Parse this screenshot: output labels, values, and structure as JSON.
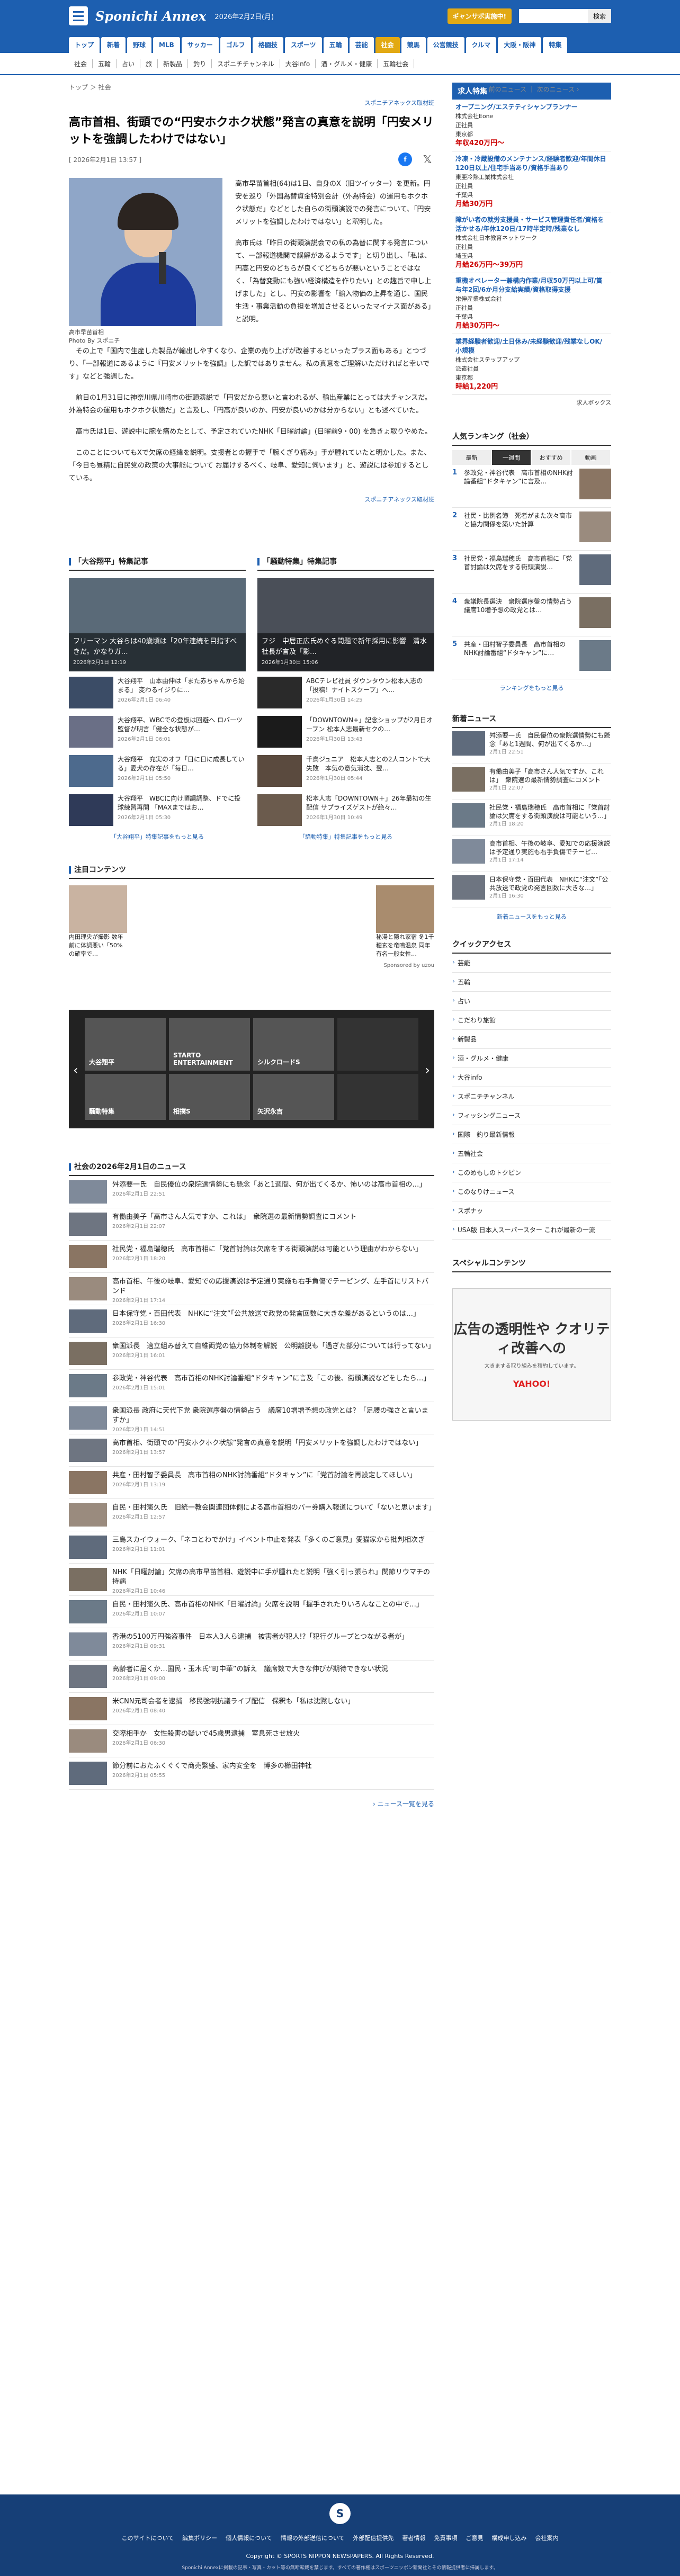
{
  "header": {
    "logo": "Sponichi Annex",
    "date": "2026年2月2日(月)",
    "smart_btn": "ギャンサポ実施中!",
    "search_btn": "検索",
    "search_placeholder": ""
  },
  "gnav": [
    "トップ",
    "新着",
    "野球",
    "MLB",
    "サッカー",
    "ゴルフ",
    "格闘技",
    "スポーツ",
    "五輪",
    "芸能",
    "社会",
    "競馬",
    "公営競技",
    "クルマ",
    "大阪・阪神",
    "特集"
  ],
  "snav": [
    "社会",
    "五輪",
    "占い",
    "旅",
    "新製品",
    "釣り",
    "スポニチチャンネル",
    "大谷info",
    "酒・グルメ・健康",
    "五輪社会"
  ],
  "breadcrumb": [
    "トップ",
    "社会"
  ],
  "pager": {
    "prev": "前のニュース",
    "next": "次のニュース"
  },
  "source_top": "スポニチアネックス取材班",
  "article": {
    "title": "高市首相、街頭での“円安ホクホク状態”発言の真意を説明「円安メリットを強調したわけではない」",
    "date": "[ 2026年2月1日 13:57 ]",
    "caption": "高市早苗首相\nPhoto By スポニチ",
    "p1": "高市早苗首相(64)は1日、自身のX（旧ツイッター）を更新。円安を巡り「外国為替資金特別会計（外為特会）の運用もホクホク状態だ」などとした自らの街頭演説での発言について、「円安メリットを強調したわけではない」と釈明した。",
    "p2": "高市氏は「昨日の街頭演説会での私の為替に関する発言について、一部報道機関で誤解があるようです」と切り出し、「私は、円高と円安のどちらが良くてどちらが悪いということではなく、「為替変動にも強い経済構造を作りたい」との趣旨で申し上げました」とし、円安の影響を「輸入物価の上昇を通じ、国民生活・事業活動の負担を増加させるといったマイナス面がある」と説明。",
    "p3": "その上で「国内で生産した製品が輸出しやすくなり、企業の売り上げが改善するといったプラス面もある」とつづり、「一部報道にあるように『円安メリットを強調』した訳ではありません。私の真意をご理解いただければと幸いです」などと強調した。",
    "p4": "前日の1月31日に神奈川県川崎市の街頭演説で「円安だから悪いと言われるが、輸出産業にとっては大チャンスだ。外為特会の運用もホクホク状態だ」と言及し、「円高が良いのか、円安が良いのかは分からない」とも述べていた。",
    "p5": "高市氏は1日、遊説中に腕を痛めたとして、予定されていたNHK「日曜討論」(日曜前9・00) を急きょ取りやめた。",
    "p6": "このことについてもXで欠席の経緯を説明。支援者との握手で「腕くぎり痛み」手が腫れていたと明かした。また、「今日も昼精に自民党の政策の大事能について お届けするべく、岐阜、愛知に伺います」と、遊説には参加するとしている。",
    "source_bottom": "スポニチアネックス取材班"
  },
  "specials": [
    {
      "title": "「大谷翔平」特集記事",
      "feat_title": "フリーマン 大谷らは40歳頃は「20年連続を目指すべきだ。かなりガ…",
      "feat_date": "2026年2月1日 12:19",
      "items": [
        {
          "text": "大谷翔平　山本由伸は「また赤ちゃんから始まる」 変わるイジりに…",
          "date": "2026年2月1日 06:40"
        },
        {
          "text": "大谷翔平、WBCでの登板は回避へ ロバーツ監督が明言「健全な状態が…",
          "date": "2026年2月1日 06:01"
        },
        {
          "text": "大谷翔平　充実のオフ「日に日に成長している」愛犬の存在が「毎日…",
          "date": "2026年2月1日 05:50"
        },
        {
          "text": "大谷翔平　WBCに向け順調調整、ドでに投球練習再開 「MAXまではお…",
          "date": "2026年2月1日 05:30"
        }
      ],
      "more": "「大谷翔平」特集記事をもっと見る"
    },
    {
      "title": "「騒動特集」特集記事",
      "feat_title": "フジ　中居正広氏めぐる問題で新年採用に影響　清水社長が言及「影…",
      "feat_date": "2026年1月30日 15:06",
      "items": [
        {
          "text": "ABCテレビ社員 ダウンタウン松本人志の「投稿！ナイトスクープ」へ…",
          "date": "2026年1月30日 14:25"
        },
        {
          "text": "「DOWNTOWN+」記念ショップが2月日オープン 松本人志最新セクの…",
          "date": "2026年1月30日 13:43"
        },
        {
          "text": "千鳥ジュニア　松本人志との2人コントで大失敗　本気の意気消沈、翌…",
          "date": "2026年1月30日 05:44"
        },
        {
          "text": "松本人志「DOWNTOWN＋」26年最初の生配信 サプライズゲストが絶々…",
          "date": "2026年1月30日 10:49"
        }
      ],
      "more": "「騒動特集」特集記事をもっと見る"
    }
  ],
  "attention": {
    "title": "注目コンテンツ",
    "items": [
      {
        "text": "内田理央が撮影 数年前に体調悪い「50%の確率で…"
      },
      {
        "text": "秘湯と隠れ家宿 冬1千穂玄を竜鳴温泉 同年有名一般女性…"
      }
    ],
    "sponsor": "Sponsored by uzou"
  },
  "carousel": [
    "大谷翔平",
    "STARTO ENTERTAINMENT",
    "シルクロードS",
    "騒動特集",
    "相撲S",
    "矢沢永吉"
  ],
  "social_news": {
    "title": "社会の2026年2月1日のニュース",
    "items": [
      {
        "text": "舛添要一氏　自民優位の衆院選情勢にも懸念「あと1週間、何が出てくるか、怖いのは高市首相の…」",
        "date": "2026年2月1日 22:51"
      },
      {
        "text": "有働由美子「高市さん人気ですか、これは」　衆院選の最新情勢調査にコメント",
        "date": "2026年2月1日 22:07"
      },
      {
        "text": "社民党・福島瑞穂氏　高市首相に「党首討論は欠席をする街頭演説は可能という理由がわからない」",
        "date": "2026年2月1日 18:20"
      },
      {
        "text": "高市首相、午後の岐阜、愛知での応援演説は予定通り実施も右手負傷でテーピング、左手首にリストバンド",
        "date": "2026年2月1日 17:14"
      },
      {
        "text": "日本保守党・百田代表　NHKに“注文”「公共放送で政党の発言回数に大きな差があるというのは…」",
        "date": "2026年2月1日 16:30"
      },
      {
        "text": "衆国派長　適立組み替えて自維両党の協力体制を解説　公明離脱も「過ぎた部分については行ってない」",
        "date": "2026年2月1日 16:01"
      },
      {
        "text": "参政党・神谷代表　高市首相のNHK討論番組“ドタキャン”に言及「この後、街頭演説などをしたら…」",
        "date": "2026年2月1日 15:01"
      },
      {
        "text": "衆国派長 政府に天代下党 衆院選序盤の情勢占う　議席10増増予想の政党とは？「足腰の強さと言いますか」",
        "date": "2026年2月1日 14:51"
      },
      {
        "text": "高市首相、街頭での“円安ホクホク状態”発言の真意を説明「円安メリットを強調したわけではない」",
        "date": "2026年2月1日 13:57"
      },
      {
        "text": "共産・田村智子委員長　高市首相のNHK討論番組“ドタキャン”に「党首討論を再設定してほしい」",
        "date": "2026年2月1日 13:19"
      },
      {
        "text": "自民・田村憲久氏　旧統一教会関連団体側による高市首相のパー券購入報道について「ないと思います」",
        "date": "2026年2月1日 12:57"
      },
      {
        "text": "三島スカイウォーク、「ネコとわでかけ」イベント中止を発表「多くのご意見」愛猫家から批判相次ぎ",
        "date": "2026年2月1日 11:01"
      },
      {
        "text": "NHK「日曜討論」欠席の高市早苗首相、遊説中に手が腫れたと説明「強く引っ張られ」関節リウマチの持病",
        "date": "2026年2月1日 10:46"
      },
      {
        "text": "自民・田村憲久氏、高市首相のNHK「日曜討論」欠席を説明「握手されたりいろんなことの中で…」",
        "date": "2026年2月1日 10:07"
      },
      {
        "text": "香港の5100万円強盗事件　日本人3人ら逮捕　被害者が犯人!?「犯行グループとつながる者が」",
        "date": "2026年2月1日 09:31"
      },
      {
        "text": "高齢者に届くか…国民・玉木氏“町中華”の訴え　議席数で大きな伸びが期待できない状況",
        "date": "2026年2月1日 09:00"
      },
      {
        "text": "米CNN元司会者を逮捕　移民強制抗議ライブ配信　保釈も「私は沈黙しない」",
        "date": "2026年2月1日 08:40"
      },
      {
        "text": "交際相手か　女性殺害の疑いで45歳男逮捕　室息死させ放火",
        "date": "2026年2月1日 06:30"
      },
      {
        "text": "節分前におたふくぐくで商売繁盛、家内安全を　博多の櫛田神社",
        "date": "2026年2月1日 05:55"
      }
    ],
    "more": "ニュース一覧を見る"
  },
  "jobs": {
    "title": "求人特集",
    "items": [
      {
        "t": "オープニング/エステティシャンプランナー",
        "c": "株式会社Eone",
        "p": "正社員",
        "l": "東京都",
        "a": "年収420万円～"
      },
      {
        "t": "冷凍・冷蔵設備のメンテナンス/経験者歓迎/年間休日120日以上/住宅手当あり/資格手当あり",
        "c": "東亜冷熱工業株式会社",
        "p": "正社員",
        "l": "千葉県",
        "a": "月給30万円"
      },
      {
        "t": "障がい者の就労支援員・サービス管理責任者/資格を活かせる/年休120日/17時半定時/残業なし",
        "c": "株式会社日本教育ネットワーク",
        "p": "正社員",
        "l": "埼玉県",
        "a": "月給26万円～39万円"
      },
      {
        "t": "重機オペレーター兼構内作業/月収50万円以上可/賞与年2回/6か月分支給実績/資格取得支援",
        "c": "栄伸産業株式会社",
        "p": "正社員",
        "l": "千葉県",
        "a": "月給30万円～"
      },
      {
        "t": "業界経験者歓迎/土日休み/未経験歓迎/残業なしOK/小規模",
        "c": "株式会社ステップアップ",
        "p": "派遣社員",
        "l": "東京都",
        "a": "時給1,220円"
      }
    ],
    "source": "求人ボックス"
  },
  "ranking": {
    "title": "人気ランキング（社会）",
    "tabs": [
      "最新",
      "一週間",
      "おすすめ",
      "動画"
    ],
    "items": [
      "参政党・神谷代表　高市首相のNHK討論番組“ドタキャン”に言及…",
      "社民・比例名簿　死者がまた次々高市と協力関係を築いた計算",
      "社民党・福島瑞穂氏　高市首相に「党首討論は欠席をする街頭演説…",
      "衆議院長選決　衆院選序盤の情勢占う　議席10増予想の政党とは…",
      "共産・田村智子委員長　高市首相のNHK討論番組“ドタキャン”に…"
    ],
    "more": "ランキングをもっと見る"
  },
  "side_news": {
    "title": "新着ニュース",
    "items": [
      {
        "t": "舛添要一氏　自民優位の衆院選情勢にも懸念「あと1週間、何が出てくるか…」",
        "d": "2月1日 22:51"
      },
      {
        "t": "有働由美子「高市さん人気ですか、これは」　衆院選の最新情勢調査にコメント",
        "d": "2月1日 22:07"
      },
      {
        "t": "社民党・福島瑞穂氏　高市首相に「党首討論は欠席をする街頭演説は可能という…」",
        "d": "2月1日 18:20"
      },
      {
        "t": "高市首相、午後の岐阜、愛知での応援演説は予定通り実施も右手負傷でテーピ…",
        "d": "2月1日 17:14"
      },
      {
        "t": "日本保守党・百田代表　NHKに“注文”「公共放送で政党の発言回数に大きな…」",
        "d": "2月1日 16:30"
      }
    ],
    "more": "新着ニュースをもっと見る"
  },
  "quick": {
    "title": "クイックアクセス",
    "items": [
      "芸能",
      "五輪",
      "占い",
      "こだわり旅館",
      "新製品",
      "酒・グルメ・健康",
      "大谷info",
      "スポニチチャンネル",
      "フィッシングニュース",
      "国際　釣り最新情報",
      "五輪社会",
      "このめもしのトクピン",
      "このなりけニュース",
      "スポナッ",
      "USA版 日本人スーパースター これが最新の一流"
    ]
  },
  "special_contents": {
    "title": "スペシャルコンテンツ",
    "ad_big": "広告の透明性や クオリティ改善への",
    "ad_small": "大きまする取り組みを積約しています。",
    "ad_brand": "YAHOO!"
  },
  "footer": {
    "links": [
      "このサイトについて",
      "編集ポリシー",
      "個人情報について",
      "情報の外部送信について",
      "外部配信提供先",
      "著者情報",
      "免責事項",
      "ご意見",
      "構成申し込み",
      "会社案内"
    ],
    "copyright": "Copyright © SPORTS NIPPON NEWSPAPERS. All Rights Reserved.",
    "note": "Sponichi Annexに掲載の記事・写真・カット等の無断転載を禁じます。すべての著作権はスポーツニッポン新聞社とその情報提供者に帰属します。"
  }
}
